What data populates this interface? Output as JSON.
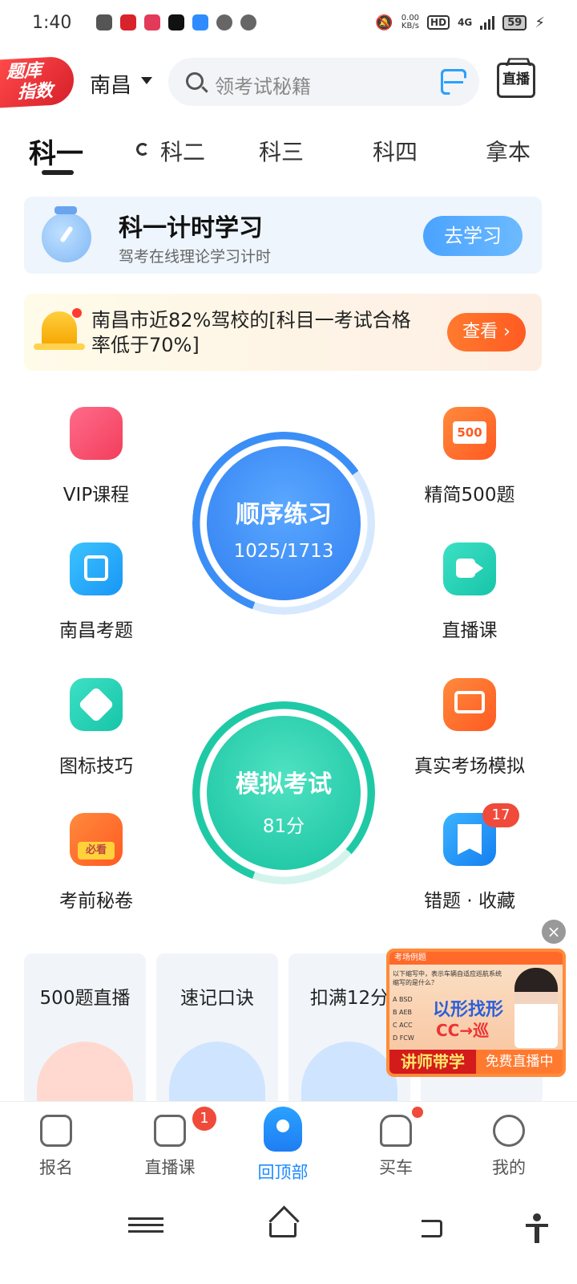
{
  "status": {
    "time": "1:40",
    "speed_value": "0.00",
    "speed_unit": "KB/s",
    "hd": "HD",
    "network": "4G",
    "battery": "59"
  },
  "header": {
    "logo_line1": "题库",
    "logo_line2": "指数",
    "city": "南昌",
    "search_placeholder": "领考试秘籍",
    "live_label": "直播"
  },
  "tabs": [
    {
      "label": "科一"
    },
    {
      "label": "科二"
    },
    {
      "label": "科三"
    },
    {
      "label": "科四"
    },
    {
      "label": "拿本"
    }
  ],
  "study_card": {
    "title": "科一计时学习",
    "subtitle": "驾考在线理论学习计时",
    "button": "去学习"
  },
  "alert_card": {
    "text": "南昌市近82%驾校的[科目一考试合格率低于70%]",
    "button": "查看 ›"
  },
  "features": {
    "vip": "VIP课程",
    "jingjian": "精简500题",
    "jingjian_icon_text": "500",
    "nanchang": "南昌考题",
    "live_course": "直播课",
    "sign_tips": "图标技巧",
    "real_exam": "真实考场模拟",
    "secret_paper": "考前秘卷",
    "secret_paper_icon_text": "必看",
    "wrong_fav": "错题 · 收藏",
    "wrong_fav_badge": "17"
  },
  "practice": {
    "title": "顺序练习",
    "value": "1025/1713",
    "progress_fraction": 0.598
  },
  "mock": {
    "title": "模拟考试",
    "value": "81分",
    "score_fraction": 0.81
  },
  "promos": [
    {
      "title": "500题直播"
    },
    {
      "title": "速记口诀"
    },
    {
      "title": "扣满12分"
    }
  ],
  "ad": {
    "close": "×",
    "header": "考场例题",
    "question": "以下缩写中，表示车辆自适应巡航系统缩写的是什么？",
    "options": [
      "A  BSD",
      "B  AEB",
      "C  ACC",
      "D  FCW"
    ],
    "big_text": "以形找形",
    "cc_text": "CC→巡",
    "footer_left": "讲师带学",
    "footer_right": "免费直播中"
  },
  "bottom_nav": [
    {
      "label": "报名"
    },
    {
      "label": "直播课",
      "badge": "1"
    },
    {
      "label": "回顶部"
    },
    {
      "label": "买车"
    },
    {
      "label": "我的"
    }
  ],
  "colors": {
    "accent_blue": "#1f8cff",
    "practice_ring": "#3a8ef6",
    "mock_ring": "#1fc9a5",
    "badge_red": "#f04a3a"
  }
}
